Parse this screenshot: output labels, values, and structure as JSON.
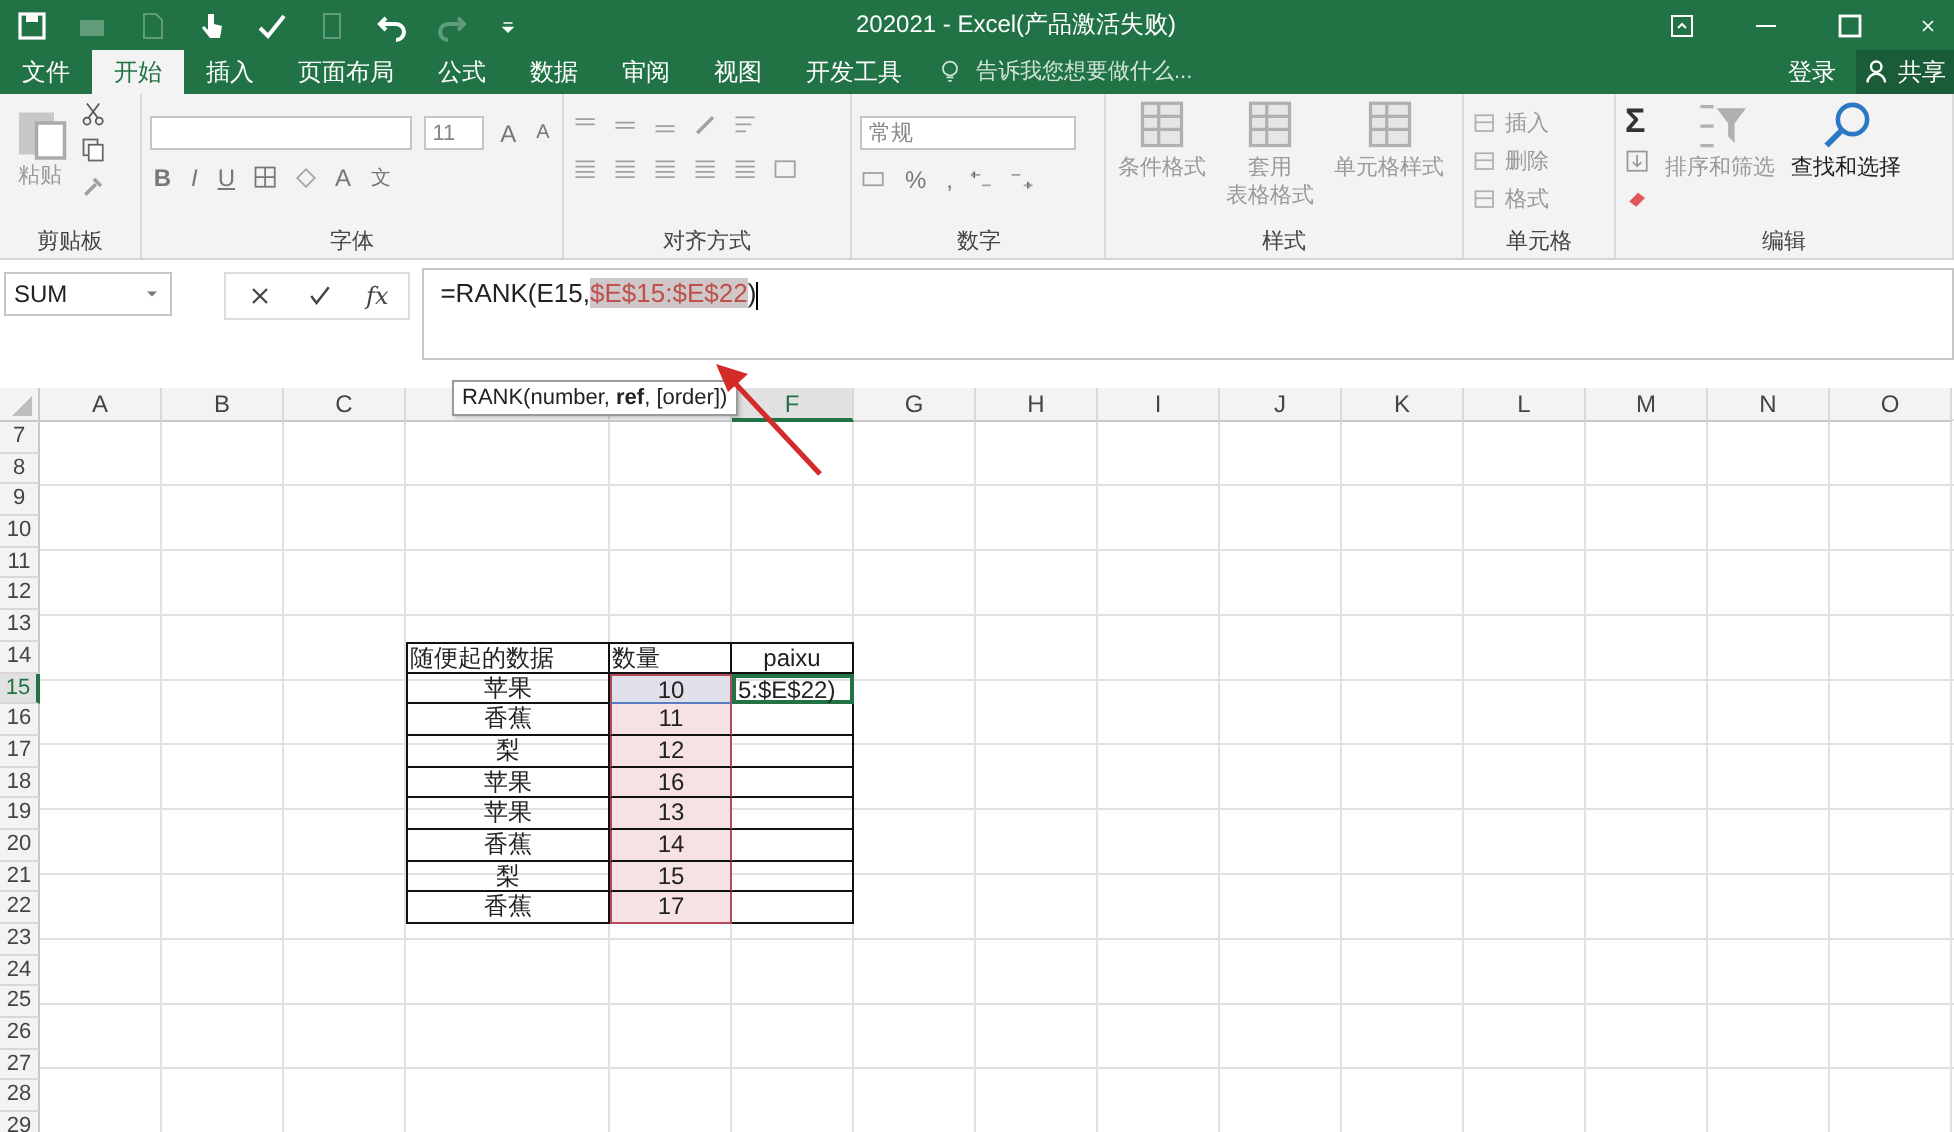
{
  "window": {
    "title": "202021 - Excel(产品激活失败)"
  },
  "tabs": [
    {
      "label": "文件",
      "selected": false
    },
    {
      "label": "开始",
      "selected": true
    },
    {
      "label": "插入",
      "selected": false
    },
    {
      "label": "页面布局",
      "selected": false
    },
    {
      "label": "公式",
      "selected": false
    },
    {
      "label": "数据",
      "selected": false
    },
    {
      "label": "审阅",
      "selected": false
    },
    {
      "label": "视图",
      "selected": false
    },
    {
      "label": "开发工具",
      "selected": false
    }
  ],
  "tell_me": {
    "placeholder": "告诉我您想要做什么..."
  },
  "account": {
    "sign_in": "登录",
    "share": "共享"
  },
  "ribbon": {
    "clipboard": {
      "label": "剪贴板",
      "paste": {
        "label": "粘贴",
        "disabled": true
      }
    },
    "font": {
      "label": "字体",
      "size": "11",
      "grow": "A",
      "shrink": "A",
      "buttons": [
        "B",
        "I",
        "U"
      ],
      "font_color": "A",
      "phonetic": "文"
    },
    "alignment": {
      "label": "对齐方式"
    },
    "number": {
      "label": "数字",
      "format": "常规",
      "percent": "%",
      "comma": ","
    },
    "styles": {
      "label": "样式",
      "buttons": [
        {
          "lines": [
            "条件格式"
          ],
          "disabled": true
        },
        {
          "lines": [
            "套用",
            "表格格式"
          ],
          "disabled": true
        },
        {
          "lines": [
            "单元格样式"
          ],
          "disabled": true
        }
      ]
    },
    "cells": {
      "label": "单元格",
      "buttons": [
        {
          "label": "插入",
          "disabled": true
        },
        {
          "label": "删除",
          "disabled": true
        },
        {
          "label": "格式",
          "disabled": true
        }
      ]
    },
    "editing": {
      "label": "编辑",
      "sum": "Σ",
      "buttons": [
        {
          "label": "排序和筛选",
          "disabled": true
        },
        {
          "label": "查找和选择",
          "disabled": false
        }
      ]
    }
  },
  "formula_bar": {
    "name_box": "SUM",
    "function_button": "fx",
    "parts": [
      {
        "kind": "plain",
        "text": "=RANK(E15,"
      },
      {
        "kind": "reference",
        "text": "$E$15:$E$22"
      },
      {
        "kind": "plain",
        "text": ")"
      }
    ],
    "tooltip": "RANK(number, **ref**, [order])"
  },
  "sheet": {
    "columns": [
      {
        "label": "A",
        "selected": false
      },
      {
        "label": "B",
        "selected": false
      },
      {
        "label": "C",
        "selected": false
      },
      {
        "selected": false
      },
      {
        "selected": false
      },
      {
        "label": "F",
        "selected": true
      },
      {
        "label": "G",
        "selected": false
      },
      {
        "label": "H",
        "selected": false
      },
      {
        "label": "I",
        "selected": false
      },
      {
        "label": "J",
        "selected": false
      },
      {
        "label": "K",
        "selected": false
      },
      {
        "label": "L",
        "selected": false
      },
      {
        "label": "M",
        "selected": false
      },
      {
        "label": "N",
        "selected": false
      },
      {
        "label": "O",
        "selected": false
      }
    ],
    "rows": [
      {
        "label": "7",
        "selected": false
      },
      {
        "label": "8",
        "selected": false
      },
      {
        "label": "9",
        "selected": false
      },
      {
        "label": "10",
        "selected": false
      },
      {
        "label": "11",
        "selected": false
      },
      {
        "label": "12",
        "selected": false
      },
      {
        "label": "13",
        "selected": false
      },
      {
        "label": "14",
        "selected": false
      },
      {
        "label": "15",
        "selected": true
      },
      {
        "label": "16",
        "selected": false
      },
      {
        "label": "17",
        "selected": false
      },
      {
        "label": "18",
        "selected": false
      },
      {
        "label": "19",
        "selected": false
      },
      {
        "label": "20",
        "selected": false
      },
      {
        "label": "21",
        "selected": false
      },
      {
        "label": "22",
        "selected": false
      },
      {
        "label": "23",
        "selected": false
      },
      {
        "label": "24",
        "selected": false
      },
      {
        "label": "25",
        "selected": false
      },
      {
        "label": "26",
        "selected": false
      },
      {
        "label": "27",
        "selected": false
      },
      {
        "label": "28",
        "selected": false
      },
      {
        "label": "29",
        "selected": false
      }
    ],
    "table": {
      "header": [
        "随便起的数据",
        "数量",
        "paixu"
      ],
      "rows": [
        [
          "苹果",
          "10",
          "5:$E$22)"
        ],
        [
          "香蕉",
          "11",
          ""
        ],
        [
          "梨",
          "12",
          ""
        ],
        [
          "苹果",
          "16",
          ""
        ],
        [
          "苹果",
          "13",
          ""
        ],
        [
          "香蕉",
          "14",
          ""
        ],
        [
          "梨",
          "15",
          ""
        ],
        [
          "香蕉",
          "17",
          ""
        ]
      ]
    }
  }
}
